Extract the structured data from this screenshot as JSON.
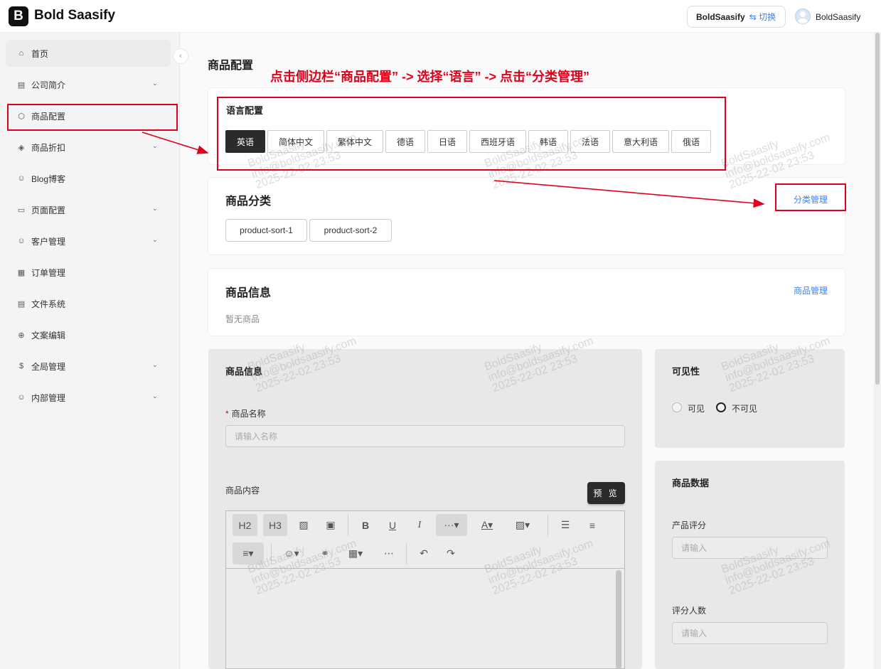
{
  "header": {
    "logo_letter": "B",
    "brand": "Bold Saasify",
    "tenant": "BoldSaasify",
    "switch_label": "⇆ 切换",
    "username": "BoldSaasify"
  },
  "sidebar": {
    "items": [
      {
        "label": "首页",
        "icon": "home-icon"
      },
      {
        "label": "公司简介",
        "icon": "building-icon",
        "expandable": true
      },
      {
        "label": "商品配置",
        "icon": "box-icon"
      },
      {
        "label": "商品折扣",
        "icon": "tag-icon",
        "expandable": true
      },
      {
        "label": "Blog博客",
        "icon": "users-icon"
      },
      {
        "label": "页面配置",
        "icon": "monitor-icon",
        "expandable": true
      },
      {
        "label": "客户管理",
        "icon": "users-icon",
        "expandable": true
      },
      {
        "label": "订单管理",
        "icon": "document-icon"
      },
      {
        "label": "文件系统",
        "icon": "file-icon"
      },
      {
        "label": "文案编辑",
        "icon": "globe-icon"
      },
      {
        "label": "全局管理",
        "icon": "dollar-icon",
        "expandable": true
      },
      {
        "label": "内部管理",
        "icon": "user-group-icon",
        "expandable": true
      }
    ]
  },
  "main": {
    "page_title": "商品配置",
    "instruction": "点击侧边栏“商品配置” -> 选择“语言” -> 点击“分类管理”",
    "language": {
      "label": "语言配置",
      "options": [
        "英语",
        "简体中文",
        "繁体中文",
        "德语",
        "日语",
        "西班牙语",
        "韩语",
        "法语",
        "意大利语",
        "俄语"
      ],
      "selected": "英语"
    },
    "category": {
      "title": "商品分类",
      "manage_link": "分类管理",
      "sorts": [
        "product-sort-1",
        "product-sort-2"
      ]
    },
    "product_info": {
      "title": "商品信息",
      "manage_link": "商品管理",
      "empty": "暂无商品"
    },
    "form": {
      "title": "商品信息",
      "name_label": "商品名称",
      "name_placeholder": "请输入名称",
      "content_label": "商品内容",
      "preview_button": "预 览",
      "toolbar": {
        "h2": "H2",
        "h3": "H3"
      }
    },
    "visibility": {
      "title": "可见性",
      "options": [
        "可见",
        "不可见"
      ],
      "selected": "不可见"
    },
    "product_data": {
      "title": "商品数据",
      "rating_label": "产品评分",
      "rating_placeholder": "请输入",
      "count_label": "评分人数",
      "count_placeholder": "请输入"
    }
  },
  "watermark": {
    "line1": "BoldSaasify",
    "line2": "info@boldsaasify.com",
    "line3": "2025-22-02 23:53"
  },
  "colors": {
    "accent_link": "#3b82f6",
    "annotation_red": "#e0001b",
    "active_button": "#2b2b2b"
  }
}
